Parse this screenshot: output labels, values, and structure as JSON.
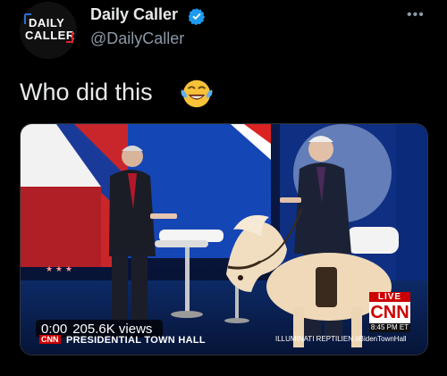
{
  "author": {
    "avatar_logo_line1": "DAILY",
    "avatar_logo_line2": "CALLER",
    "display_name": "Daily Caller",
    "handle": "@DailyCaller",
    "verified": true
  },
  "more_menu_icon": "more-horizontal-icon",
  "tweet": {
    "text": "Who did this",
    "emoji": "laughing-with-tears-emoji"
  },
  "video": {
    "time": "0:00",
    "views": "205.6K views",
    "network_logo": "CNN",
    "lower_third_title": "PRESIDENTIAL TOWN HALL",
    "lower_third_right": "ILLUMINATI  REPTILIEN  #BidenTownHall",
    "live_label": "LIVE",
    "channel_logo": "CNN",
    "clock": "8:45 PM ET"
  },
  "colors": {
    "background": "#000000",
    "primary_text": "#e7e9ea",
    "secondary_text": "#8b98a5",
    "verified_blue": "#1d9bf0",
    "cnn_red": "#cc0000"
  }
}
